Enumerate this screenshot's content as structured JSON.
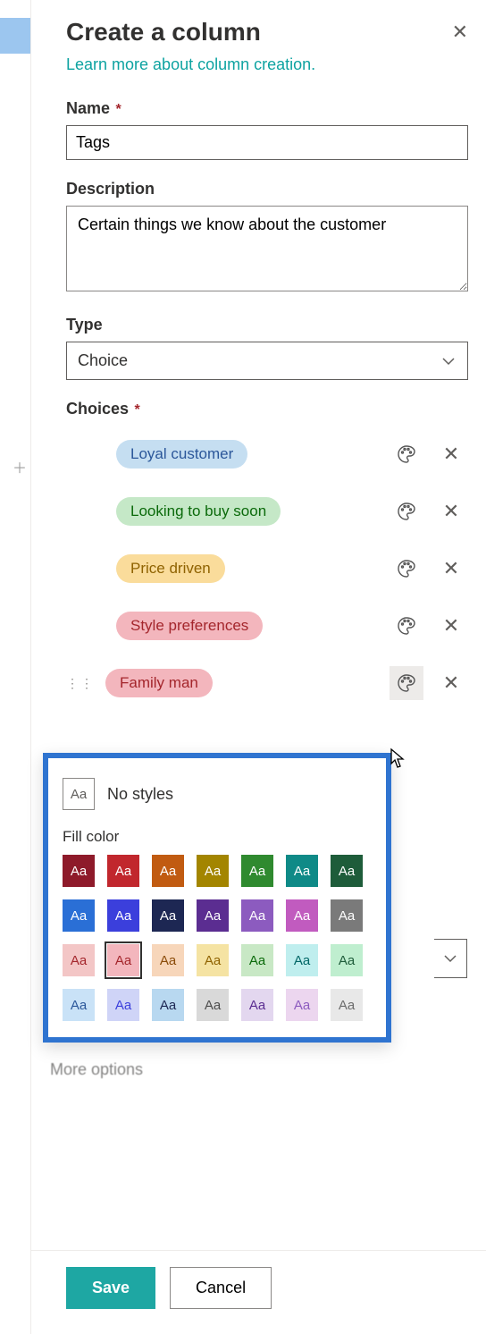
{
  "header": {
    "title": "Create a column",
    "learn_more": "Learn more about column creation."
  },
  "fields": {
    "name_label": "Name",
    "name_value": "Tags",
    "description_label": "Description",
    "description_value": "Certain things we know about the customer",
    "type_label": "Type",
    "type_value": "Choice",
    "choices_label": "Choices"
  },
  "choices": [
    {
      "label": "Loyal customer",
      "bg": "#c5def1",
      "fg": "#2b579a"
    },
    {
      "label": "Looking to buy soon",
      "bg": "#c5e8c7",
      "fg": "#0b6a0b"
    },
    {
      "label": "Price driven",
      "bg": "#fadc9b",
      "fg": "#8f6200"
    },
    {
      "label": "Style preferences",
      "bg": "#f3b6bd",
      "fg": "#a4262c"
    },
    {
      "label": "Family man",
      "bg": "#f3b6bd",
      "fg": "#a4262c"
    }
  ],
  "popup": {
    "no_styles_label": "No styles",
    "fill_color_label": "Fill color",
    "swatch_text": "Aa",
    "selected_index": 15,
    "colors": [
      {
        "bg": "#8e1a2a",
        "fg": "#fff",
        "name": "dark-red"
      },
      {
        "bg": "#c1272d",
        "fg": "#fff",
        "name": "red"
      },
      {
        "bg": "#c15b11",
        "fg": "#fff",
        "name": "orange"
      },
      {
        "bg": "#a38500",
        "fg": "#fff",
        "name": "gold"
      },
      {
        "bg": "#2f8a2f",
        "fg": "#fff",
        "name": "green"
      },
      {
        "bg": "#0f8a87",
        "fg": "#fff",
        "name": "teal"
      },
      {
        "bg": "#1e5c3a",
        "fg": "#fff",
        "name": "dark-green"
      },
      {
        "bg": "#2a6fd6",
        "fg": "#fff",
        "name": "blue"
      },
      {
        "bg": "#3b3fdc",
        "fg": "#fff",
        "name": "indigo"
      },
      {
        "bg": "#1d2753",
        "fg": "#fff",
        "name": "navy"
      },
      {
        "bg": "#5b2d91",
        "fg": "#fff",
        "name": "purple"
      },
      {
        "bg": "#8c5bbf",
        "fg": "#fff",
        "name": "lavender"
      },
      {
        "bg": "#c15bbf",
        "fg": "#fff",
        "name": "magenta"
      },
      {
        "bg": "#7a7a7a",
        "fg": "#fff",
        "name": "gray"
      },
      {
        "bg": "#f3c6c6",
        "fg": "#a4262c",
        "name": "light-red-1"
      },
      {
        "bg": "#f3b6bd",
        "fg": "#a4262c",
        "name": "light-red-2"
      },
      {
        "bg": "#f7d6ba",
        "fg": "#8a4b08",
        "name": "light-orange"
      },
      {
        "bg": "#f5e3a3",
        "fg": "#8f6200",
        "name": "light-gold"
      },
      {
        "bg": "#c8e8c5",
        "fg": "#0b6a0b",
        "name": "light-green"
      },
      {
        "bg": "#bfeeee",
        "fg": "#006666",
        "name": "light-teal"
      },
      {
        "bg": "#bfeecf",
        "fg": "#1e5c3a",
        "name": "light-mint"
      },
      {
        "bg": "#c9e2f7",
        "fg": "#2b579a",
        "name": "light-blue-1"
      },
      {
        "bg": "#cfd4f7",
        "fg": "#3b3fdc",
        "name": "light-indigo"
      },
      {
        "bg": "#b8d8f0",
        "fg": "#1d2753",
        "name": "light-blue-2"
      },
      {
        "bg": "#d9d9d9",
        "fg": "#4d4d4d",
        "name": "light-gray-1"
      },
      {
        "bg": "#e3d7ef",
        "fg": "#5b2d91",
        "name": "light-purple"
      },
      {
        "bg": "#ecd6ef",
        "fg": "#8c5bbf",
        "name": "light-lavender"
      },
      {
        "bg": "#e8e8e8",
        "fg": "#6b6b6b",
        "name": "light-gray-2"
      }
    ]
  },
  "more_options_label": "More options",
  "footer": {
    "save": "Save",
    "cancel": "Cancel"
  }
}
